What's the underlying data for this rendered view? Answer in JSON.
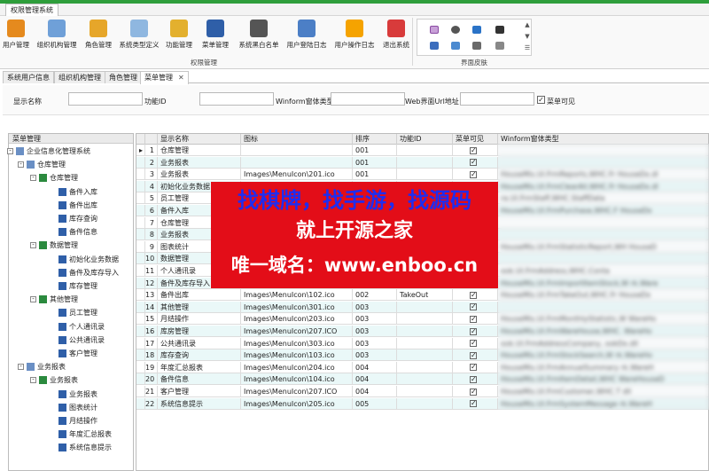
{
  "app": {
    "title": "权限管理系统"
  },
  "ribbon": {
    "buttons": [
      {
        "label": "用户管理",
        "icon": "user-icon"
      },
      {
        "label": "组织机构管理",
        "icon": "org-icon"
      },
      {
        "label": "角色管理",
        "icon": "role-icon"
      },
      {
        "label": "系统类型定义",
        "icon": "system-type-icon"
      },
      {
        "label": "功能管理",
        "icon": "key-icon"
      },
      {
        "label": "菜单管理",
        "icon": "menu-book-icon"
      },
      {
        "label": "系统黑白名单",
        "icon": "blacklist-person-icon"
      },
      {
        "label": "用户登陆日志",
        "icon": "login-log-icon"
      },
      {
        "label": "用户操作日志",
        "icon": "warning-icon"
      },
      {
        "label": "退出系统",
        "icon": "exit-icon"
      }
    ],
    "group_label": "权限管理",
    "skin_group_label": "界面皮肤"
  },
  "doc_tabs": [
    {
      "label": "系统用户信息"
    },
    {
      "label": "组织机构管理"
    },
    {
      "label": "角色管理"
    },
    {
      "label": "菜单管理",
      "active": true
    }
  ],
  "filter": {
    "display_name_label": "显示名称",
    "function_id_label": "功能ID",
    "winform_type_label": "Winform窗体类型",
    "web_url_label": "Web界面Url地址",
    "visible_label": "菜单可见",
    "visible_checked": true
  },
  "tree": {
    "title": "菜单管理",
    "nodes": [
      {
        "label": "企业信息化管理系统",
        "level": 0,
        "exp": "-",
        "icon": "system-node-icon"
      },
      {
        "label": "仓库管理",
        "level": 1,
        "exp": "-",
        "icon": "menu-folder-icon"
      },
      {
        "label": "仓库管理",
        "level": 2,
        "exp": "-",
        "icon": "menu-group-icon"
      },
      {
        "label": "备件入库",
        "level": 3,
        "icon": "menu-item-icon"
      },
      {
        "label": "备件出库",
        "level": 3,
        "icon": "menu-item-icon"
      },
      {
        "label": "库存查询",
        "level": 3,
        "icon": "menu-item-icon"
      },
      {
        "label": "备件信息",
        "level": 3,
        "icon": "menu-item-icon"
      },
      {
        "label": "数据管理",
        "level": 2,
        "exp": "-",
        "icon": "menu-group-icon"
      },
      {
        "label": "初始化业务数据",
        "level": 3,
        "icon": "menu-item-icon"
      },
      {
        "label": "备件及库存导入",
        "level": 3,
        "icon": "menu-item-icon"
      },
      {
        "label": "库存管理",
        "level": 3,
        "icon": "menu-item-icon"
      },
      {
        "label": "其他管理",
        "level": 2,
        "exp": "-",
        "icon": "menu-group-icon"
      },
      {
        "label": "员工管理",
        "level": 3,
        "icon": "menu-item-icon"
      },
      {
        "label": "个人通讯录",
        "level": 3,
        "icon": "menu-item-icon"
      },
      {
        "label": "公共通讯录",
        "level": 3,
        "icon": "menu-item-icon"
      },
      {
        "label": "客户管理",
        "level": 3,
        "icon": "menu-item-icon"
      },
      {
        "label": "业务报表",
        "level": 1,
        "exp": "-",
        "icon": "menu-folder-icon"
      },
      {
        "label": "业务报表",
        "level": 2,
        "exp": "-",
        "icon": "menu-group-icon"
      },
      {
        "label": "业务报表",
        "level": 3,
        "icon": "menu-item-icon"
      },
      {
        "label": "图表统计",
        "level": 3,
        "icon": "menu-item-icon"
      },
      {
        "label": "月结操作",
        "level": 3,
        "icon": "menu-item-icon"
      },
      {
        "label": "年度汇总报表",
        "level": 3,
        "icon": "menu-item-icon"
      },
      {
        "label": "系统信息提示",
        "level": 3,
        "icon": "menu-item-icon"
      }
    ]
  },
  "grid": {
    "columns": [
      "",
      "",
      "显示名称",
      "图标",
      "排序",
      "功能ID",
      "菜单可见",
      "Winform窗体类型"
    ],
    "rows": [
      {
        "marker": "▸",
        "no": "1",
        "name": "仓库管理",
        "icon": "",
        "sort": "001",
        "fid": "",
        "vis": true,
        "winform": ""
      },
      {
        "marker": "",
        "no": "2",
        "name": "业务报表",
        "icon": "",
        "sort": "001",
        "fid": "",
        "vis": true,
        "winform": ""
      },
      {
        "marker": "",
        "no": "3",
        "name": "业务报表",
        "icon": "Images\\MenuIcon\\201.ico",
        "sort": "001",
        "fid": "",
        "vis": true,
        "winform": "HouseMis.UI.FrmReports,WHC.Fr              HouseDx.dl"
      },
      {
        "marker": "",
        "no": "4",
        "name": "初始化业务数据",
        "icon": "Images\\MenuIcon\\",
        "sort": "001",
        "fid": "",
        "vis": true,
        "winform": "HouseMis.UI.FrmClearAll,WHC.Fr              HouseDx.dl"
      },
      {
        "marker": "",
        "no": "5",
        "name": "员工管理",
        "icon": "",
        "sort": "",
        "fid": "",
        "vis": true,
        "winform": "ra.UI.FrmStaff,WHC.StaffData"
      },
      {
        "marker": "",
        "no": "6",
        "name": "备件入库",
        "icon": "",
        "sort": "",
        "fid": "",
        "vis": true,
        "winform": "HouseMis.UI.FrmPurchase,WHC.F              HouseDx"
      },
      {
        "marker": "",
        "no": "7",
        "name": "仓库管理",
        "icon": "",
        "sort": "",
        "fid": "",
        "vis": true,
        "winform": ""
      },
      {
        "marker": "",
        "no": "8",
        "name": "业务报表",
        "icon": "",
        "sort": "",
        "fid": "",
        "vis": true,
        "winform": ""
      },
      {
        "marker": "",
        "no": "9",
        "name": "图表统计",
        "icon": "",
        "sort": "",
        "fid": "",
        "vis": true,
        "winform": "HouseMis.UI.FrmStatisticReport,WH              HouseD"
      },
      {
        "marker": "",
        "no": "10",
        "name": "数据管理",
        "icon": "",
        "sort": "",
        "fid": "",
        "vis": true,
        "winform": ""
      },
      {
        "marker": "",
        "no": "11",
        "name": "个人通讯录",
        "icon": "",
        "sort": "",
        "fid": "",
        "vis": true,
        "winform": "ook.UI.FrmAddress,WHC.Conta"
      },
      {
        "marker": "",
        "no": "12",
        "name": "备件及库存导入",
        "icon": "",
        "sort": "",
        "fid": "",
        "vis": true,
        "winform": "HouseMis.UI.FrmImportItemStock,W              rk.Ware"
      },
      {
        "marker": "",
        "no": "13",
        "name": "备件出库",
        "icon": "Images\\MenuIcon\\102.ico",
        "sort": "002",
        "fid": "TakeOut",
        "vis": true,
        "winform": "HouseMis.UI.FrmTakeOut,WHC.Fr              HouseDx"
      },
      {
        "marker": "",
        "no": "14",
        "name": "其他管理",
        "icon": "Images\\MenuIcon\\301.ico",
        "sort": "003",
        "fid": "",
        "vis": true,
        "winform": ""
      },
      {
        "marker": "",
        "no": "15",
        "name": "月结操作",
        "icon": "Images\\MenuIcon\\203.ico",
        "sort": "003",
        "fid": "",
        "vis": true,
        "winform": "HouseMis.UI.FrmMonthlyStatistic,W              WareHo"
      },
      {
        "marker": "",
        "no": "16",
        "name": "库房管理",
        "icon": "Images\\MenuIcon\\207.ICO",
        "sort": "003",
        "fid": "",
        "vis": true,
        "winform": "HouseMis.UI.FrmWareHouse,WHC.              WareHo"
      },
      {
        "marker": "",
        "no": "17",
        "name": "公共通讯录",
        "icon": "Images\\MenuIcon\\303.ico",
        "sort": "003",
        "fid": "",
        "vis": true,
        "winform": "ook.UI.FrmAddressCompany,              ookDx.dll"
      },
      {
        "marker": "",
        "no": "18",
        "name": "库存查询",
        "icon": "Images\\MenuIcon\\103.ico",
        "sort": "003",
        "fid": "",
        "vis": true,
        "winform": "HouseMis.UI.FrmStockSearch,W              rk.WareHo"
      },
      {
        "marker": "",
        "no": "19",
        "name": "年度汇总报表",
        "icon": "Images\\MenuIcon\\204.ico",
        "sort": "004",
        "fid": "",
        "vis": true,
        "winform": "HouseMis.UI.FrmAnnualSummary              rk.WareH"
      },
      {
        "marker": "",
        "no": "20",
        "name": "备件信息",
        "icon": "Images\\MenuIcon\\104.ico",
        "sort": "004",
        "fid": "",
        "vis": true,
        "winform": "HouseMis.UI.FrmItemDetail,WHC              WareHouseD"
      },
      {
        "marker": "",
        "no": "21",
        "name": "客户管理",
        "icon": "Images\\MenuIcon\\207.ICO",
        "sort": "004",
        "fid": "",
        "vis": true,
        "winform": "HouseMis.UI.FrmCustomer,WHC.T              dll"
      },
      {
        "marker": "",
        "no": "22",
        "name": "系统信息提示",
        "icon": "Images\\MenuIcon\\205.ico",
        "sort": "005",
        "fid": "",
        "vis": true,
        "winform": "HouseMis.UI.FrmSystemMessage              rk.WareH"
      }
    ]
  },
  "watermark": {
    "line1": "找棋牌，找手游，找源码",
    "line2": "就上开源之家",
    "line3": "唯一域名：www.enboo.cn"
  },
  "colors": {
    "accent_green": "#2e9e3b",
    "watermark_red": "#e30d18",
    "watermark_blue": "#1f2df0",
    "row_alt": "#eaf8f8"
  }
}
